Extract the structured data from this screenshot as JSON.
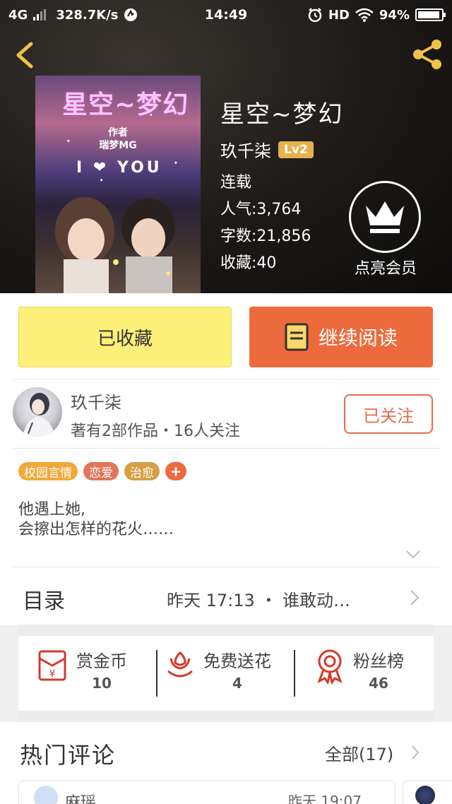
{
  "status_bar": {
    "network": "4G",
    "speed": "328.7K/s",
    "time": "14:49",
    "hd": "HD",
    "battery": "94%",
    "battery_level": 0.94
  },
  "book": {
    "cover_title": "星空~梦幻",
    "cover_byline_1": "作者",
    "cover_byline_2": "瑞梦MG",
    "cover_iyou": "I ❤ YOU",
    "title": "星空~梦幻",
    "author": "玖千柒",
    "level": "Lv2",
    "status": "连载",
    "popularity": "人气:3,764",
    "words": "字数:21,856",
    "favorites": "收藏:40",
    "vip_label": "点亮会员"
  },
  "actions": {
    "collected_label": "已收藏",
    "continue_label": "继续阅读"
  },
  "author_block": {
    "name": "玖千柒",
    "stats": "著有2部作品・16人关注",
    "follow_label": "已关注"
  },
  "tags": [
    {
      "label": "校园言情",
      "color": "#f0a93a"
    },
    {
      "label": "恋爱",
      "color": "#e0775a"
    },
    {
      "label": "治愈",
      "color": "#d4a042"
    }
  ],
  "tag_plus": "+",
  "synopsis": {
    "line1": "他遇上她,",
    "line2": "会擦出怎样的花火……"
  },
  "toc": {
    "label": "目录",
    "info": "昨天 17:13 ・ 谁敢动…"
  },
  "gifts": [
    {
      "label": "赏金币",
      "count": "10",
      "icon": "red-envelope-icon"
    },
    {
      "label": "免费送花",
      "count": "4",
      "icon": "flower-icon"
    },
    {
      "label": "粉丝榜",
      "count": "46",
      "icon": "ribbon-medal-icon"
    }
  ],
  "comments": {
    "title": "热门评论",
    "all_label": "全部(17)",
    "first_user": "麻瑶",
    "first_time": "昨天 19:07"
  },
  "colors": {
    "accent_orange": "#ec6a3c",
    "collected_yellow": "#fcf079",
    "level_gold": "#e6b24c"
  }
}
